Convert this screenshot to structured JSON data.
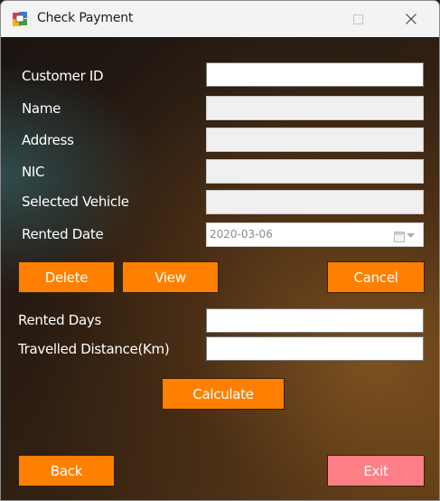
{
  "window": {
    "title": "Check Payment",
    "minimize_glyph": "—",
    "close_glyph": "✕"
  },
  "form": {
    "customer_id": {
      "label": "Customer ID",
      "value": ""
    },
    "name": {
      "label": "Name",
      "value": ""
    },
    "address": {
      "label": "Address",
      "value": ""
    },
    "nic": {
      "label": "NIC",
      "value": ""
    },
    "selected_vehicle": {
      "label": "Selected Vehicle",
      "value": ""
    },
    "rented_date": {
      "label": "Rented Date",
      "value": "2020-03-06"
    },
    "rented_days": {
      "label": "Rented Days",
      "value": ""
    },
    "travelled_distance": {
      "label": "Travelled Distance(Km)",
      "value": ""
    }
  },
  "buttons": {
    "delete": "Delete",
    "view": "View",
    "cancel": "Cancel",
    "calculate": "Calculate",
    "back": "Back",
    "exit": "Exit"
  },
  "colors": {
    "button_orange": "#ff8000",
    "button_exit": "#ff7f86"
  }
}
